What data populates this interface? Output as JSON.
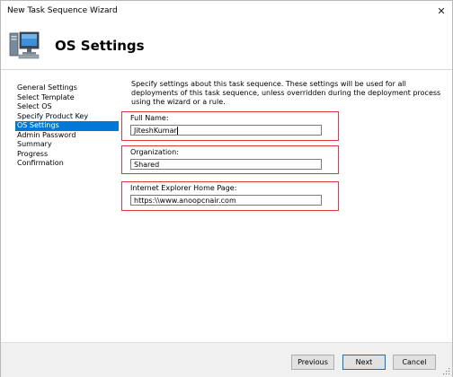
{
  "window": {
    "title": "New Task Sequence Wizard",
    "close_glyph": "✕"
  },
  "header": {
    "title": "OS Settings",
    "icon": "computer-icon"
  },
  "steps": [
    {
      "label": "General Settings",
      "active": false
    },
    {
      "label": "Select Template",
      "active": false
    },
    {
      "label": "Select OS",
      "active": false
    },
    {
      "label": "Specify Product Key",
      "active": false
    },
    {
      "label": "OS Settings",
      "active": true
    },
    {
      "label": "Admin Password",
      "active": false
    },
    {
      "label": "Summary",
      "active": false
    },
    {
      "label": "Progress",
      "active": false
    },
    {
      "label": "Confirmation",
      "active": false
    }
  ],
  "description": "Specify settings about this task sequence.  These settings will be used for all deployments of this task sequence, unless overridden during the deployment process using the wizard or a rule.",
  "form": {
    "full_name": {
      "label": "Full Name:",
      "value": "JiteshKumar"
    },
    "organization": {
      "label": "Organization:",
      "value": "Shared"
    },
    "ie_home_page": {
      "label": "Internet Explorer Home Page:",
      "value": "https:\\\\www.anoopcnair.com"
    }
  },
  "buttons": {
    "previous": "Previous",
    "next": "Next",
    "cancel": "Cancel"
  },
  "colors": {
    "accent": "#0078d7",
    "highlight_box": "#e0393c"
  }
}
